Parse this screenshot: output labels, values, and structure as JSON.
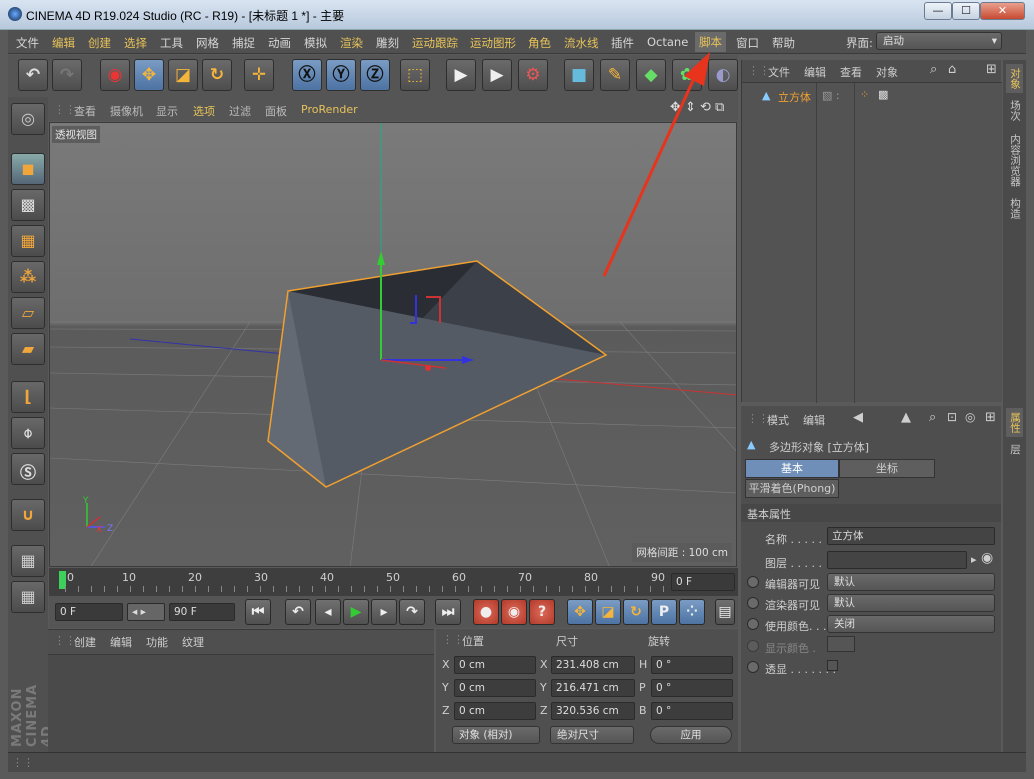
{
  "window": {
    "title": "CINEMA 4D R19.024 Studio (RC - R19) - [未标题 1 *] - 主要",
    "min": "—",
    "max": "☐",
    "close": "✕"
  },
  "menu": {
    "items": [
      "文件",
      "编辑",
      "创建",
      "选择",
      "工具",
      "网格",
      "捕捉",
      "动画",
      "模拟",
      "渲染",
      "雕刻",
      "运动跟踪",
      "运动图形",
      "角色",
      "流水线",
      "插件",
      "Octane",
      "脚本",
      "窗口",
      "帮助"
    ],
    "layout_label": "界面:",
    "layout_value": "启动"
  },
  "viewport": {
    "menu": [
      "查看",
      "摄像机",
      "显示",
      "选项",
      "过滤",
      "面板",
      "ProRender"
    ],
    "label": "透视视图",
    "grid": "网格间距 : 100 cm"
  },
  "timeline": {
    "ticks": [
      "0",
      "10",
      "20",
      "30",
      "40",
      "50",
      "60",
      "70",
      "80",
      "90"
    ],
    "end_field": "0 F"
  },
  "transport": {
    "start": "0 F",
    "end": "90 F"
  },
  "material": {
    "menu": [
      "创建",
      "编辑",
      "功能",
      "纹理"
    ]
  },
  "coords": {
    "headers": [
      "位置",
      "尺寸",
      "旋转"
    ],
    "rows": [
      {
        "a": "X",
        "pos": "0 cm",
        "b": "X",
        "size": "231.408 cm",
        "c": "H",
        "rot": "0 °"
      },
      {
        "a": "Y",
        "pos": "0 cm",
        "b": "Y",
        "size": "216.471 cm",
        "c": "P",
        "rot": "0 °"
      },
      {
        "a": "Z",
        "pos": "0 cm",
        "b": "Z",
        "size": "320.536 cm",
        "c": "B",
        "rot": "0 °"
      }
    ],
    "mode": "对象 (相对)",
    "size_mode": "绝对尺寸",
    "apply": "应用"
  },
  "objects": {
    "menu": [
      "文件",
      "编辑",
      "查看",
      "对象"
    ],
    "item": "立方体"
  },
  "attributes": {
    "menu": [
      "模式",
      "编辑"
    ],
    "title": "多边形对象 [立方体]",
    "tabs": [
      "基本",
      "坐标"
    ],
    "phong": "平滑着色(Phong)",
    "section": "基本属性",
    "fields": [
      {
        "label": "名称 . . . . .",
        "value": "立方体"
      },
      {
        "label": "图层 . . . . .",
        "value": ""
      },
      {
        "label": "编辑器可见",
        "value": "默认"
      },
      {
        "label": "渲染器可见",
        "value": "默认"
      },
      {
        "label": "使用颜色. . .",
        "value": "关闭"
      },
      {
        "label": "显示颜色 .",
        "value": ""
      },
      {
        "label": "透显 . . . . . . .",
        "value": ""
      }
    ]
  },
  "right_tabs": [
    "对象",
    "场次",
    "内容浏览器",
    "构造",
    "属性",
    "层"
  ],
  "brand": "MAXON CINEMA 4D",
  "colors": {
    "accent": "#e7c35a",
    "selection": "#f0a030",
    "arrow": "#e8341c"
  }
}
